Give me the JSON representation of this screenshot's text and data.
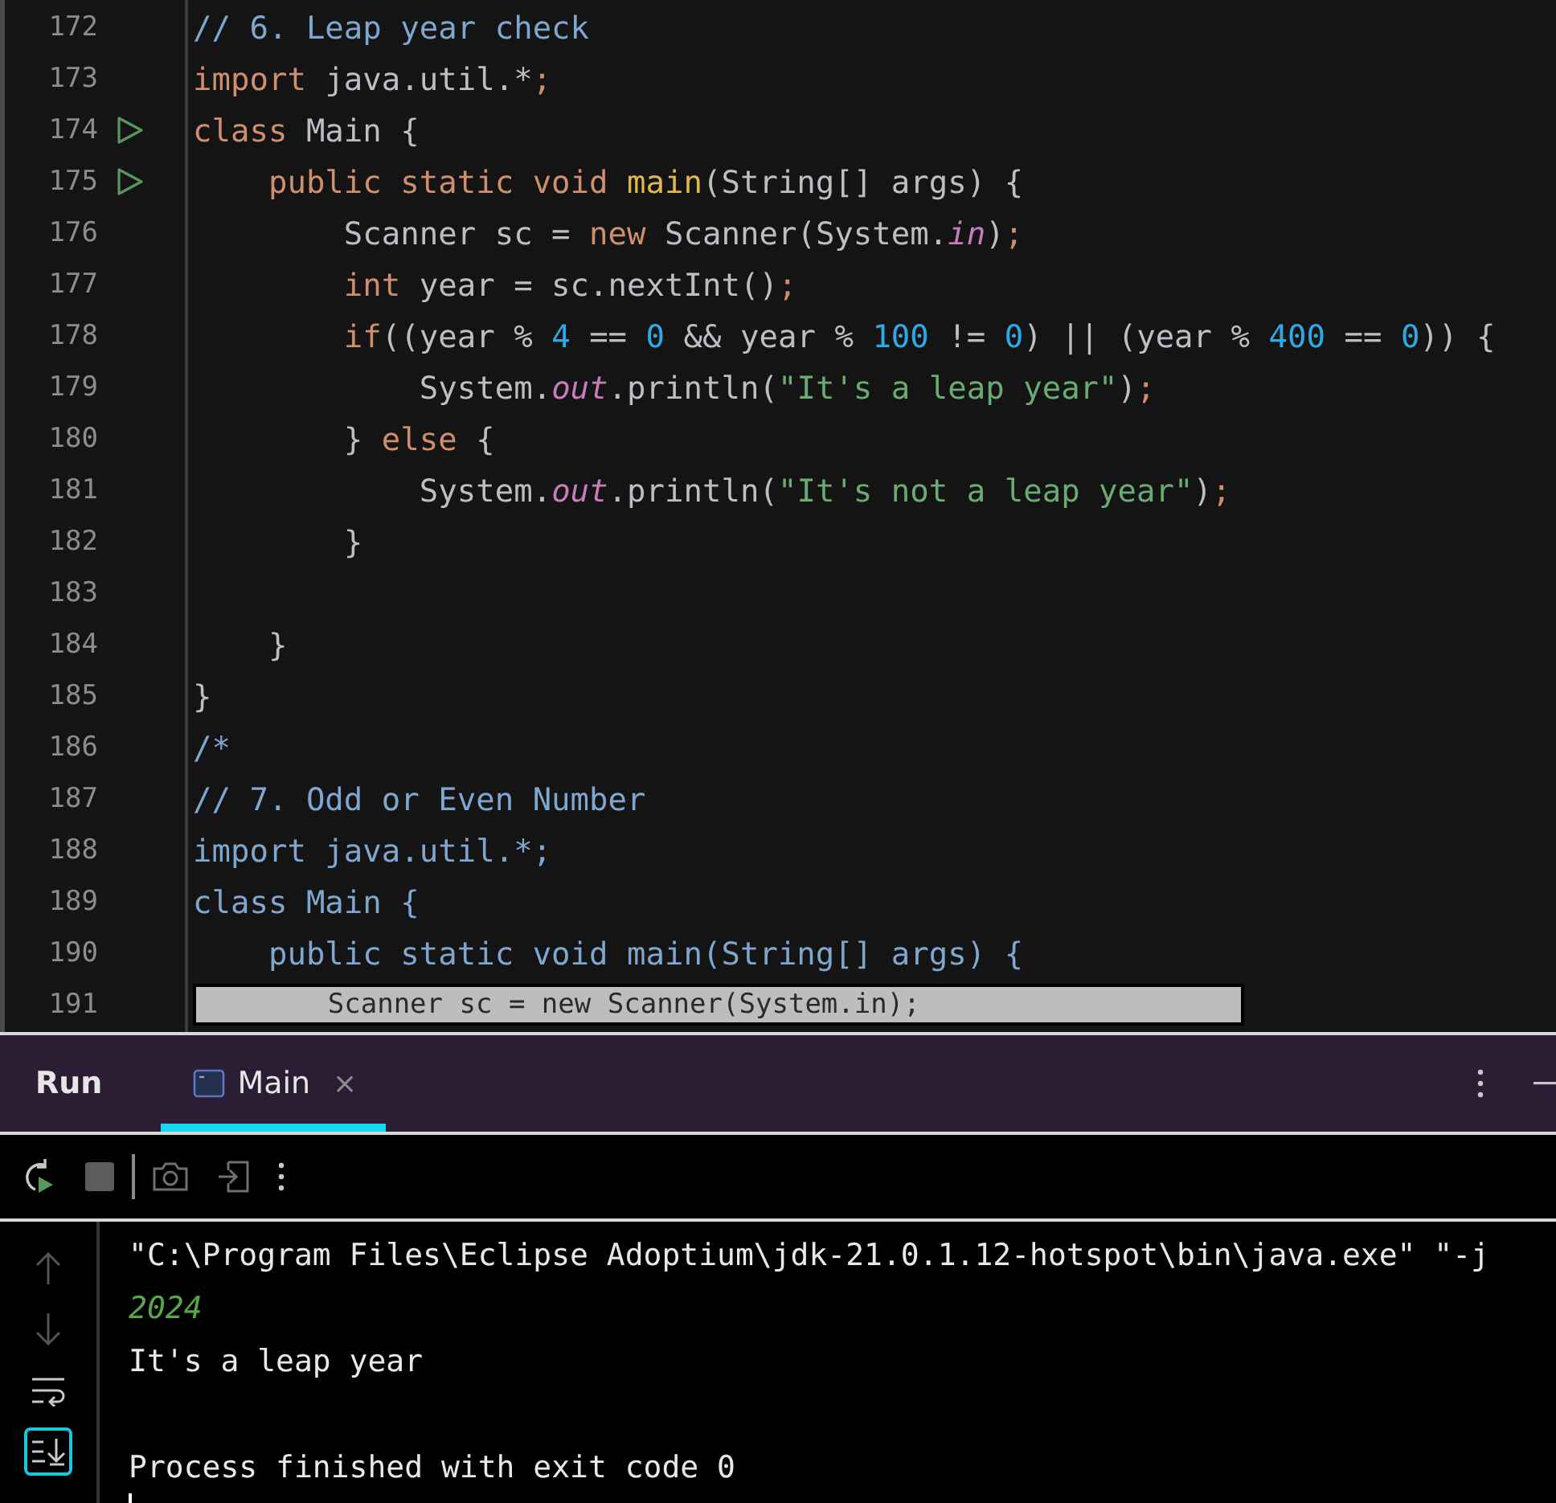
{
  "editor": {
    "lines": [
      {
        "number": "172",
        "run": false,
        "tokens": [
          {
            "kind": "comment",
            "text": "// 6. Leap year check"
          }
        ]
      },
      {
        "number": "173",
        "run": false,
        "tokens": [
          {
            "kind": "keyword",
            "text": "import"
          },
          {
            "kind": "plain",
            "text": " java.util.*"
          },
          {
            "kind": "punct",
            "text": ";"
          }
        ]
      },
      {
        "number": "174",
        "run": true,
        "tokens": [
          {
            "kind": "keyword",
            "text": "class"
          },
          {
            "kind": "plain",
            "text": " Main {"
          }
        ]
      },
      {
        "number": "175",
        "run": true,
        "tokens": [
          {
            "kind": "keyword",
            "text": "    public static void"
          },
          {
            "kind": "method",
            "text": " main"
          },
          {
            "kind": "plain",
            "text": "(String[] args) {"
          }
        ]
      },
      {
        "number": "176",
        "run": false,
        "tokens": [
          {
            "kind": "plain",
            "text": "        Scanner sc = "
          },
          {
            "kind": "keyword",
            "text": "new"
          },
          {
            "kind": "plain",
            "text": " Scanner(System."
          },
          {
            "kind": "field",
            "text": "in"
          },
          {
            "kind": "plain",
            "text": ")"
          },
          {
            "kind": "punct",
            "text": ";"
          }
        ]
      },
      {
        "number": "177",
        "run": false,
        "tokens": [
          {
            "kind": "keyword",
            "text": "        int"
          },
          {
            "kind": "plain",
            "text": " year = sc.nextInt()"
          },
          {
            "kind": "punct",
            "text": ";"
          }
        ]
      },
      {
        "number": "178",
        "run": false,
        "tokens": [
          {
            "kind": "keyword",
            "text": "        if"
          },
          {
            "kind": "plain",
            "text": "((year % "
          },
          {
            "kind": "number",
            "text": "4"
          },
          {
            "kind": "plain",
            "text": " == "
          },
          {
            "kind": "number",
            "text": "0"
          },
          {
            "kind": "plain",
            "text": " && year % "
          },
          {
            "kind": "number",
            "text": "100"
          },
          {
            "kind": "plain",
            "text": " != "
          },
          {
            "kind": "number",
            "text": "0"
          },
          {
            "kind": "plain",
            "text": ") || (year % "
          },
          {
            "kind": "number",
            "text": "400"
          },
          {
            "kind": "plain",
            "text": " == "
          },
          {
            "kind": "number",
            "text": "0"
          },
          {
            "kind": "plain",
            "text": ")) {"
          }
        ]
      },
      {
        "number": "179",
        "run": false,
        "tokens": [
          {
            "kind": "plain",
            "text": "            System."
          },
          {
            "kind": "field",
            "text": "out"
          },
          {
            "kind": "plain",
            "text": ".println("
          },
          {
            "kind": "string",
            "text": "\"It's a leap year\""
          },
          {
            "kind": "plain",
            "text": ")"
          },
          {
            "kind": "punct",
            "text": ";"
          }
        ]
      },
      {
        "number": "180",
        "run": false,
        "tokens": [
          {
            "kind": "plain",
            "text": "        } "
          },
          {
            "kind": "keyword",
            "text": "else"
          },
          {
            "kind": "plain",
            "text": " {"
          }
        ]
      },
      {
        "number": "181",
        "run": false,
        "tokens": [
          {
            "kind": "plain",
            "text": "            System."
          },
          {
            "kind": "field",
            "text": "out"
          },
          {
            "kind": "plain",
            "text": ".println("
          },
          {
            "kind": "string",
            "text": "\"It's not a leap year\""
          },
          {
            "kind": "plain",
            "text": ")"
          },
          {
            "kind": "punct",
            "text": ";"
          }
        ]
      },
      {
        "number": "182",
        "run": false,
        "tokens": [
          {
            "kind": "plain",
            "text": "        }"
          }
        ]
      },
      {
        "number": "183",
        "run": false
      },
      {
        "number": "184",
        "run": false,
        "tokens": [
          {
            "kind": "plain",
            "text": "    }"
          }
        ]
      },
      {
        "number": "185",
        "run": false,
        "tokens": [
          {
            "kind": "plain",
            "text": "}"
          }
        ]
      },
      {
        "number": "186",
        "run": false,
        "tokens": [
          {
            "kind": "comment",
            "text": "/*"
          }
        ]
      },
      {
        "number": "187",
        "run": false,
        "tokens": [
          {
            "kind": "comment",
            "text": "// 7. Odd or Even Number"
          }
        ]
      },
      {
        "number": "188",
        "run": false,
        "tokens": [
          {
            "kind": "comment",
            "text": "import java.util.*;"
          }
        ]
      },
      {
        "number": "189",
        "run": false,
        "tokens": [
          {
            "kind": "comment",
            "text": "class Main {"
          }
        ]
      },
      {
        "number": "190",
        "run": false,
        "tokens": [
          {
            "kind": "comment",
            "text": "    public static void main(String[] args) {"
          }
        ]
      }
    ],
    "sticky_line": {
      "number": "191",
      "text": "        Scanner sc = new Scanner(System.in);"
    }
  },
  "run_panel": {
    "title": "Run",
    "tabs": [
      {
        "label": "Main",
        "selected": true,
        "close": "×"
      }
    ],
    "toolbar": [
      {
        "kind": "rerun"
      },
      {
        "kind": "stop"
      },
      {
        "kind": "divider"
      },
      {
        "kind": "camera"
      },
      {
        "kind": "enter"
      },
      {
        "kind": "more"
      }
    ],
    "side_tools": [
      {
        "kind": "up",
        "on": false
      },
      {
        "kind": "down",
        "on": false
      },
      {
        "kind": "wrap",
        "on": false
      },
      {
        "kind": "scroll-end",
        "on": true
      }
    ],
    "console": [
      {
        "kind": "command",
        "text": "\"C:\\Program Files\\Eclipse Adoptium\\jdk-21.0.1.12-hotspot\\bin\\java.exe\" \"-j"
      },
      {
        "kind": "input",
        "text": "2024"
      },
      {
        "kind": "output",
        "text": "It's a leap year"
      },
      {
        "kind": "blank"
      },
      {
        "kind": "output",
        "text": "Process finished with exit code 0"
      }
    ]
  }
}
